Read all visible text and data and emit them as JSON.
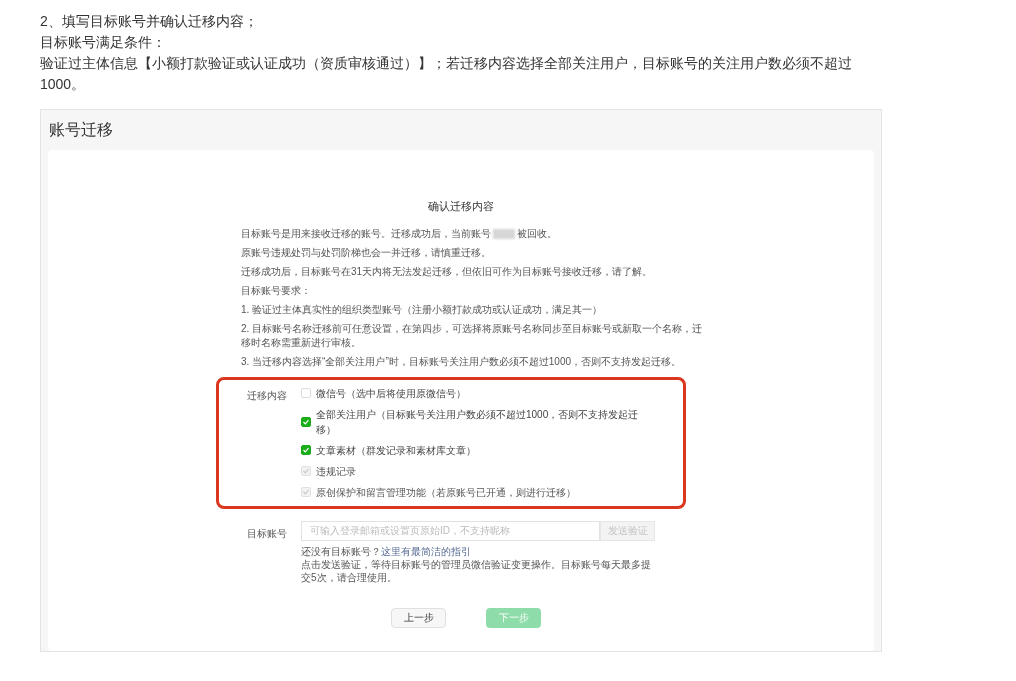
{
  "intro": [
    "2、填写目标账号并确认迁移内容；",
    "目标账号满足条件：",
    "验证过主体信息【小额打款验证或认证成功（资质审核通过）】；若迁移内容选择全部关注用户，目标账号的关注用户数必须不超过1000。"
  ],
  "panel": {
    "title": "账号迁移"
  },
  "dialog": {
    "title": "确认迁移内容",
    "notice": {
      "before": "目标账号是用来接收迁移的账号。迁移成功后，当前账号",
      "after": "被回收。"
    },
    "paragraphs": [
      "原账号违规处罚与处罚阶梯也会一并迁移，请慎重迁移。",
      "迁移成功后，目标账号在31天内将无法发起迁移，但依旧可作为目标账号接收迁移，请了解。",
      "目标账号要求：",
      "1. 验证过主体真实性的组织类型账号（注册小额打款成功或认证成功，满足其一）",
      "2. 目标账号名称迁移前可任意设置，在第四步，可选择将原账号名称同步至目标账号或新取一个名称，迁移时名称需重新进行审核。",
      "3. 当迁移内容选择“全部关注用户”时，目标账号关注用户数必须不超过1000，否则不支持发起迁移。"
    ],
    "content_label": "迁移内容",
    "options": [
      {
        "label": "微信号（选中后将使用原微信号）",
        "checked": false,
        "disabled": false
      },
      {
        "label": "全部关注用户（目标账号关注用户数必须不超过1000，否则不支持发起迁移）",
        "checked": true,
        "disabled": false
      },
      {
        "label": "文章素材（群发记录和素材库文章）",
        "checked": true,
        "disabled": false
      },
      {
        "label": "违规记录",
        "checked": true,
        "disabled": true
      },
      {
        "label": "原创保护和留言管理功能（若原账号已开通，则进行迁移）",
        "checked": true,
        "disabled": true
      }
    ],
    "target_label": "目标账号",
    "target_placeholder": "可输入登录邮箱或设置页原始ID，不支持昵称",
    "send_button": "发送验证",
    "hint_question": "还没有目标账号？",
    "hint_link": "这里有最简洁的指引",
    "hint_note": "点击发送验证，等待目标账号的管理员微信验证变更操作。目标账号每天最多提交5次，请合理使用。",
    "prev_button": "上一步",
    "next_button": {
      "label": "下一步",
      "disabled": true
    }
  }
}
